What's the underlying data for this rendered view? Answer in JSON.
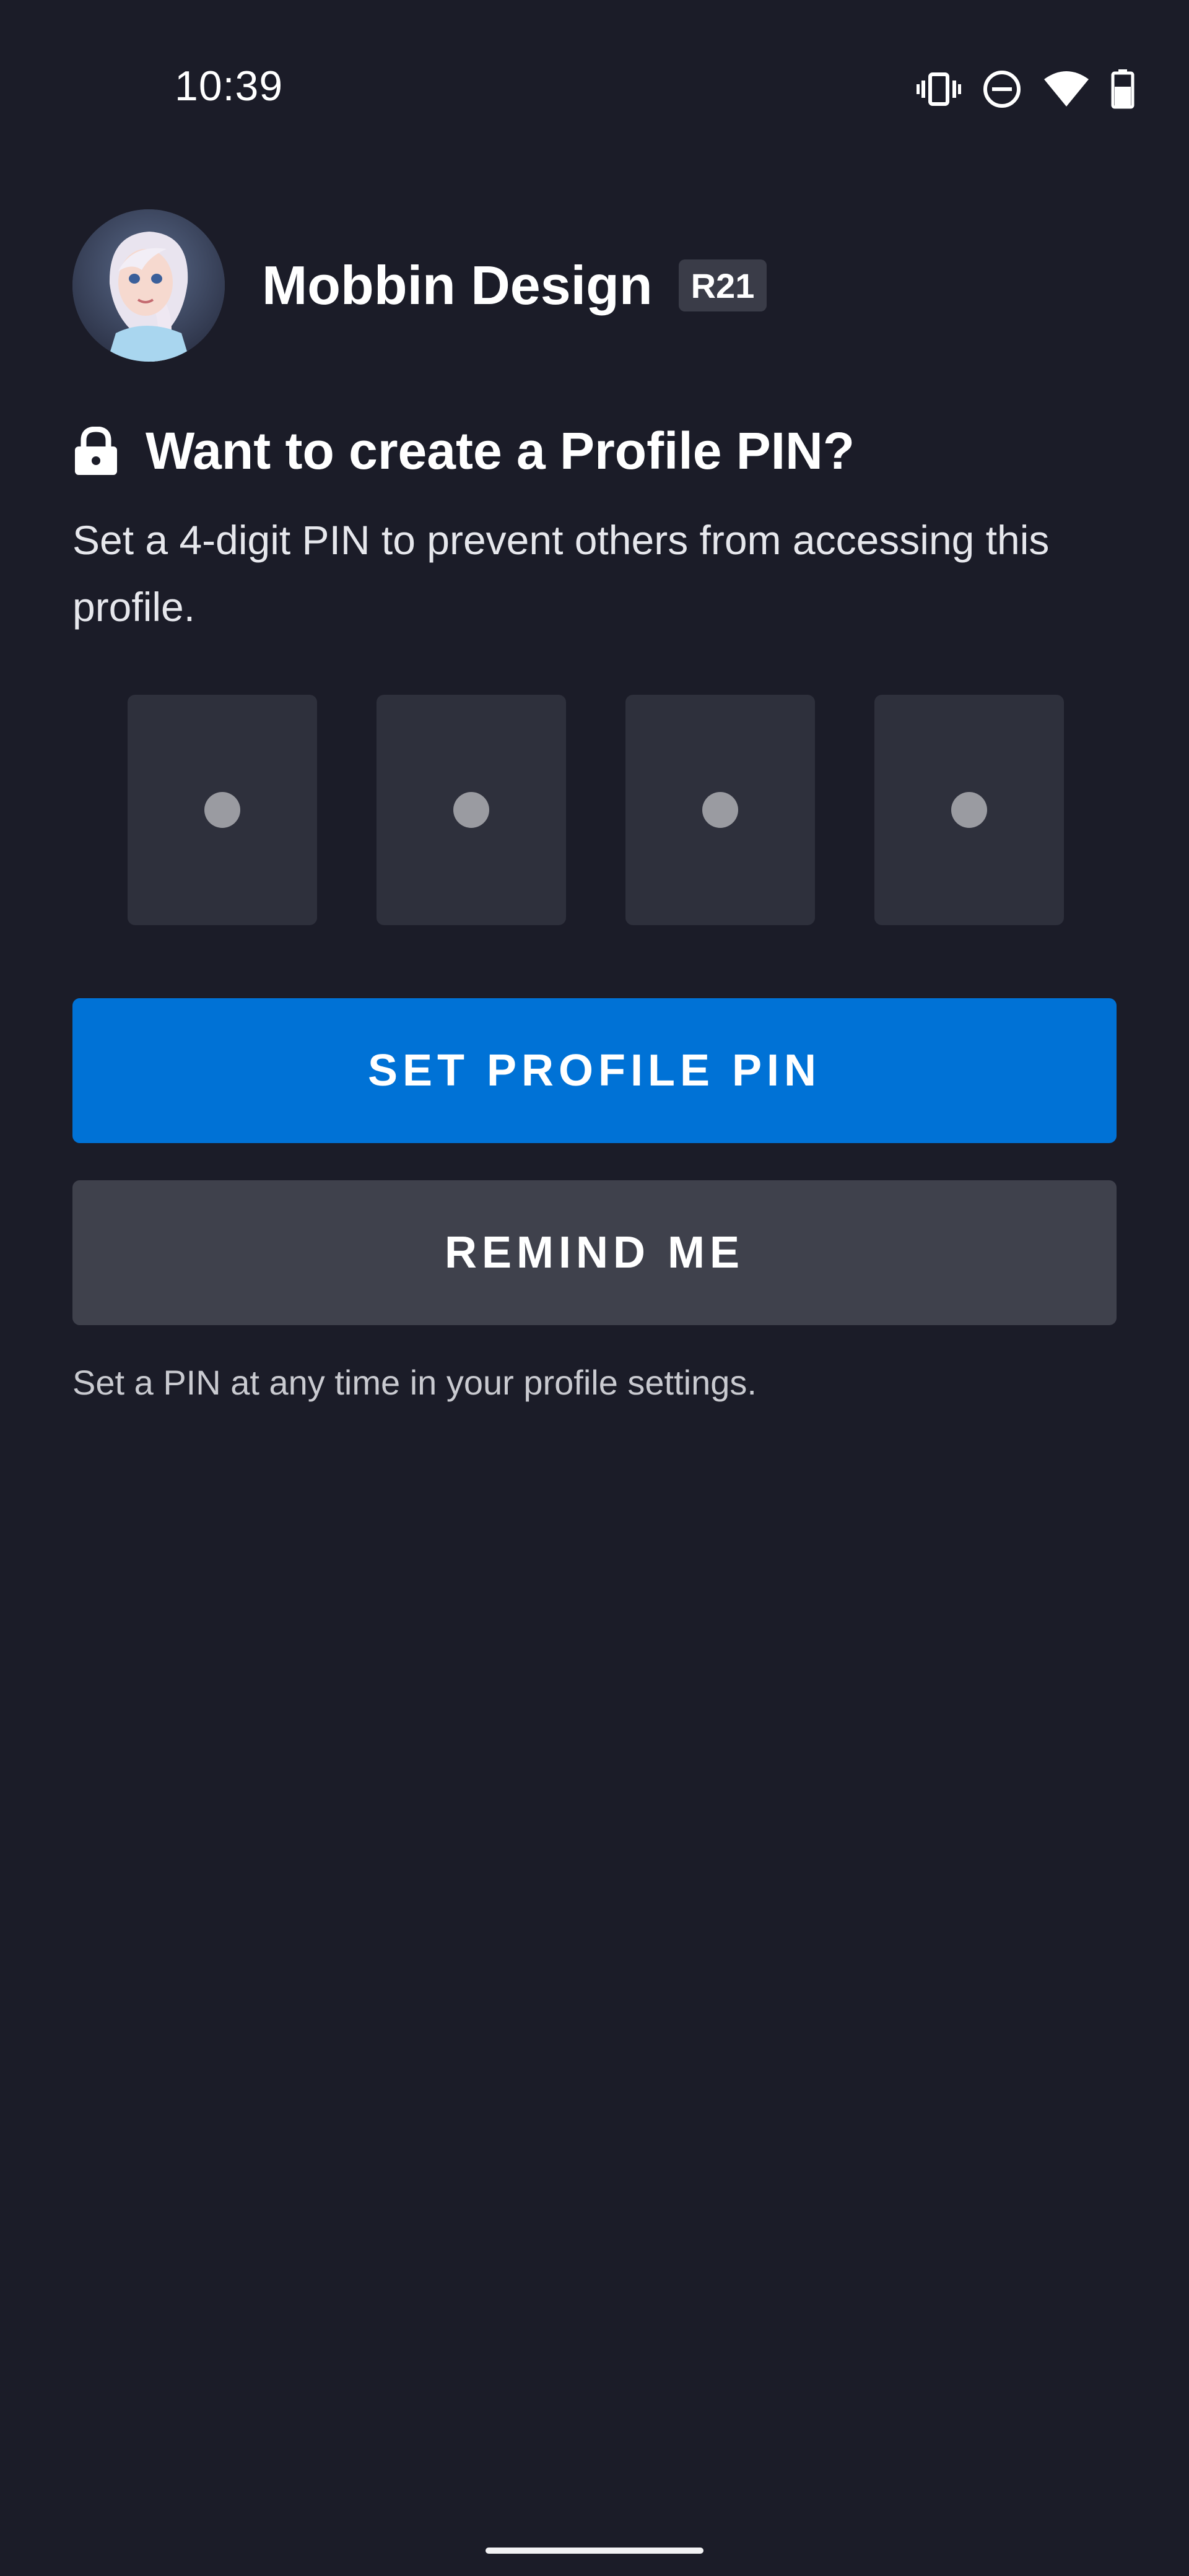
{
  "status_bar": {
    "time": "10:39",
    "icons": [
      "vibrate-icon",
      "do-not-disturb-icon",
      "wifi-icon",
      "battery-icon"
    ]
  },
  "profile": {
    "name": "Mobbin Design",
    "rating": "R21",
    "avatar_icon": "avatar"
  },
  "pin_prompt": {
    "icon": "lock-icon",
    "title": "Want to create a Profile PIN?",
    "description": "Set a 4-digit PIN to prevent others from accessing this profile."
  },
  "pin_entry": {
    "digits": [
      "",
      "",
      "",
      ""
    ]
  },
  "actions": {
    "set_pin_label": "SET PROFILE PIN",
    "remind_label": "REMIND ME",
    "footnote": "Set a PIN at any time in your profile settings."
  },
  "colors": {
    "background": "#1b1c28",
    "primary": "#0072d6",
    "secondary": "#3f414c",
    "pin_box": "#2e303c"
  }
}
